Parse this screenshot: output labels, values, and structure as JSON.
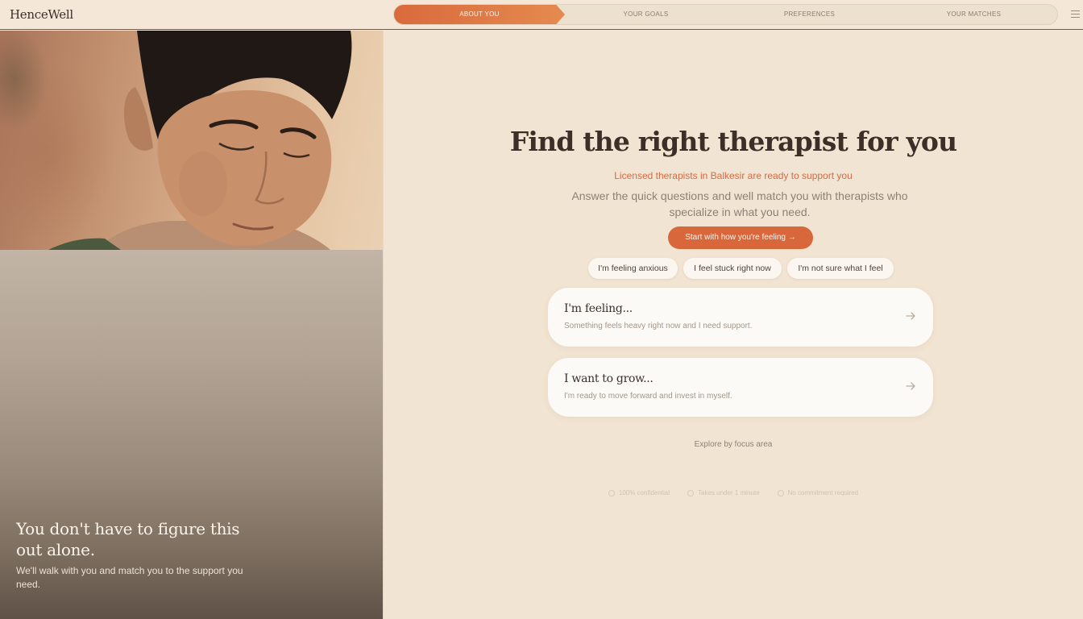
{
  "brand": {
    "logo": "HenceWell"
  },
  "stepper": {
    "steps": [
      {
        "label": "ABOUT YOU",
        "active": true
      },
      {
        "label": "YOUR GOALS",
        "active": false
      },
      {
        "label": "PREFERENCES",
        "active": false
      },
      {
        "label": "YOUR MATCHES",
        "active": false
      }
    ]
  },
  "menu": {
    "icon": "hamburger-menu-icon"
  },
  "left_panel": {
    "photo_alt": "",
    "tagline": "You don't have to figure this out alone.",
    "subtext": "We'll walk with you and match you to the support you need."
  },
  "main": {
    "headline": "Find the right therapist for you",
    "locale_line": "Licensed therapists in Balkesir are ready to support you",
    "intro": "Answer the quick questions and well match you with therapists who specialize in what you need.",
    "cta_label": "Start with how you're feeling →",
    "chips": [
      "I'm feeling anxious",
      "I feel stuck right now",
      "I'm not sure what I feel"
    ],
    "cards": [
      {
        "title": "I'm feeling...",
        "desc": "Something feels heavy right now and I need support.",
        "icon": "arrow-right-icon"
      },
      {
        "title": "I want to grow...",
        "desc": "I'm ready to move forward and invest in myself.",
        "icon": "arrow-right-icon"
      }
    ],
    "explore_label": "Explore by focus area",
    "trust_items": [
      "100% confidential",
      "Takes under 1 minute",
      "No commitment required"
    ]
  },
  "colors": {
    "background": "#f2e4d2",
    "accent": "#d8673c",
    "text_dark": "#3b2f28",
    "text_muted": "#8e8075"
  }
}
